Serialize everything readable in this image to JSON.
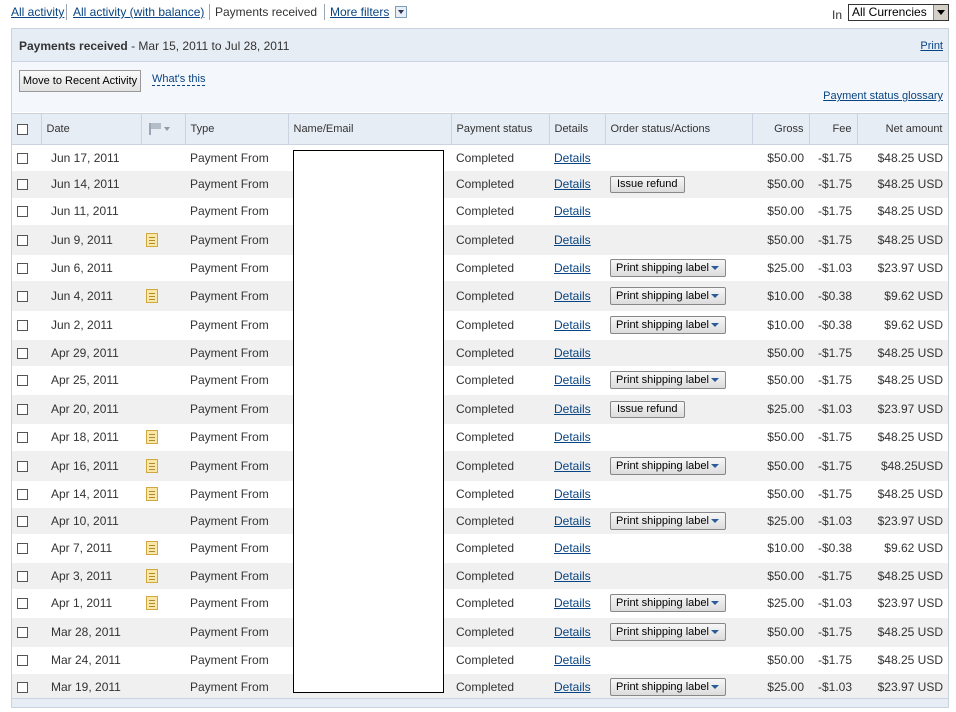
{
  "top_tabs": {
    "all_activity": "All activity",
    "all_activity_balance": "All activity (with balance)",
    "payments_received": "Payments received",
    "more_filters": "More filters"
  },
  "currency": {
    "label": "In",
    "selected": "All Currencies"
  },
  "panel": {
    "title": "Payments received",
    "date_range": " - Mar 15, 2011 to Jul 28, 2011",
    "print": "Print",
    "move_button": "Move to Recent Activity",
    "whats_this": "What's this",
    "glossary": "Payment status glossary"
  },
  "columns": {
    "date": "Date",
    "type": "Type",
    "name_email": "Name/Email",
    "payment_status": "Payment status",
    "details": "Details",
    "order_status": "Order status/Actions",
    "gross": "Gross",
    "fee": "Fee",
    "net": "Net amount"
  },
  "rows": [
    {
      "date": "Jun 17, 2011",
      "note": false,
      "type": "Payment From",
      "status": "Completed",
      "details": "Details",
      "action": "",
      "gross": "$50.00",
      "fee": "-$1.75",
      "net": "$48.25 USD"
    },
    {
      "date": "Jun 14, 2011",
      "note": false,
      "type": "Payment From",
      "status": "Completed",
      "details": "Details",
      "action": "Issue refund",
      "gross": "$50.00",
      "fee": "-$1.75",
      "net": "$48.25 USD"
    },
    {
      "date": "Jun 11, 2011",
      "note": false,
      "type": "Payment From",
      "status": "Completed",
      "details": "Details",
      "action": "",
      "gross": "$50.00",
      "fee": "-$1.75",
      "net": "$48.25 USD"
    },
    {
      "date": "Jun 9, 2011",
      "note": true,
      "type": "Payment From",
      "status": "Completed",
      "details": "Details",
      "action": "",
      "gross": "$50.00",
      "fee": "-$1.75",
      "net": "$48.25 USD"
    },
    {
      "date": "Jun 6, 2011",
      "note": false,
      "type": "Payment From",
      "status": "Completed",
      "details": "Details",
      "action": "Print shipping label",
      "gross": "$25.00",
      "fee": "-$1.03",
      "net": "$23.97 USD"
    },
    {
      "date": "Jun 4, 2011",
      "note": true,
      "type": "Payment From",
      "status": "Completed",
      "details": "Details",
      "action": "Print shipping label",
      "gross": "$10.00",
      "fee": "-$0.38",
      "net": "$9.62 USD"
    },
    {
      "date": "Jun 2, 2011",
      "note": false,
      "type": "Payment From",
      "status": "Completed",
      "details": "Details",
      "action": "Print shipping label",
      "gross": "$10.00",
      "fee": "-$0.38",
      "net": "$9.62 USD"
    },
    {
      "date": "Apr 29, 2011",
      "note": false,
      "type": "Payment From",
      "status": "Completed",
      "details": "Details",
      "action": "",
      "gross": "$50.00",
      "fee": "-$1.75",
      "net": "$48.25 USD"
    },
    {
      "date": "Apr 25, 2011",
      "note": false,
      "type": "Payment From",
      "status": "Completed",
      "details": "Details",
      "action": "Print shipping label",
      "gross": "$50.00",
      "fee": "-$1.75",
      "net": "$48.25 USD"
    },
    {
      "date": "Apr 20, 2011",
      "note": false,
      "type": "Payment From",
      "status": "Completed",
      "details": "Details",
      "action": "Issue refund",
      "gross": "$25.00",
      "fee": "-$1.03",
      "net": "$23.97 USD"
    },
    {
      "date": "Apr 18, 2011",
      "note": true,
      "type": "Payment From",
      "status": "Completed",
      "details": "Details",
      "action": "",
      "gross": "$50.00",
      "fee": "-$1.75",
      "net": "$48.25 USD"
    },
    {
      "date": "Apr 16, 2011",
      "note": true,
      "type": "Payment From",
      "status": "Completed",
      "details": "Details",
      "action": "Print shipping label",
      "gross": "$50.00",
      "fee": "-$1.75",
      "net": "$48.25USD"
    },
    {
      "date": "Apr 14, 2011",
      "note": true,
      "type": "Payment From",
      "status": "Completed",
      "details": "Details",
      "action": "",
      "gross": "$50.00",
      "fee": "-$1.75",
      "net": "$48.25 USD"
    },
    {
      "date": "Apr 10, 2011",
      "note": false,
      "type": "Payment From",
      "status": "Completed",
      "details": "Details",
      "action": "Print shipping label",
      "gross": "$25.00",
      "fee": "-$1.03",
      "net": "$23.97 USD"
    },
    {
      "date": "Apr 7, 2011",
      "note": true,
      "type": "Payment From",
      "status": "Completed",
      "details": "Details",
      "action": "",
      "gross": "$10.00",
      "fee": "-$0.38",
      "net": "$9.62 USD"
    },
    {
      "date": "Apr 3, 2011",
      "note": true,
      "type": "Payment From",
      "status": "Completed",
      "details": "Details",
      "action": "",
      "gross": "$50.00",
      "fee": "-$1.75",
      "net": "$48.25 USD"
    },
    {
      "date": "Apr 1, 2011",
      "note": true,
      "type": "Payment From",
      "status": "Completed",
      "details": "Details",
      "action": "Print shipping label",
      "gross": "$25.00",
      "fee": "-$1.03",
      "net": "$23.97 USD"
    },
    {
      "date": "Mar 28, 2011",
      "note": false,
      "type": "Payment From",
      "status": "Completed",
      "details": "Details",
      "action": "Print shipping label",
      "gross": "$50.00",
      "fee": "-$1.75",
      "net": "$48.25 USD"
    },
    {
      "date": "Mar 24, 2011",
      "note": false,
      "type": "Payment From",
      "status": "Completed",
      "details": "Details",
      "action": "",
      "gross": "$50.00",
      "fee": "-$1.75",
      "net": "$48.25 USD"
    },
    {
      "date": "Mar 19, 2011",
      "note": false,
      "type": "Payment From",
      "status": "Completed",
      "details": "Details",
      "action": "Print shipping label",
      "gross": "$25.00",
      "fee": "-$1.03",
      "net": "$23.97 USD"
    }
  ]
}
